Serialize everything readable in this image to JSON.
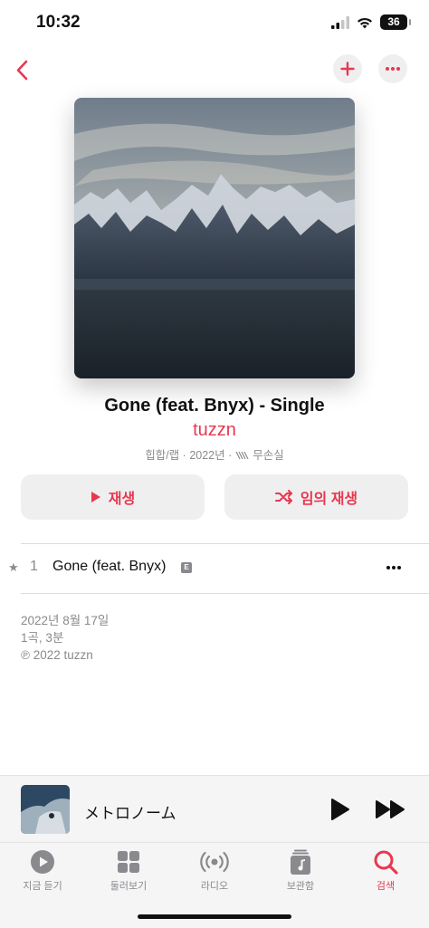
{
  "status_bar": {
    "time": "10:32",
    "battery": "36"
  },
  "album": {
    "title": "Gone (feat. Bnyx) - Single",
    "artist": "tuzzn",
    "genre": "힙합/랩",
    "year": "2022년",
    "lossless": "무손실",
    "separator": "·"
  },
  "actions": {
    "play_label": "재생",
    "shuffle_label": "임의 재생"
  },
  "tracks": [
    {
      "number": "1",
      "title": "Gone (feat. Bnyx)",
      "explicit": "E",
      "star": "★"
    }
  ],
  "info": {
    "release_date": "2022년 8월 17일",
    "summary": "1곡, 3분",
    "copyright": "℗ 2022 tuzzn"
  },
  "now_playing": {
    "title": "メトロノーム"
  },
  "tabs": [
    {
      "label": "지금 듣기",
      "icon": "play-circle-icon"
    },
    {
      "label": "둘러보기",
      "icon": "grid-icon"
    },
    {
      "label": "라디오",
      "icon": "radio-icon"
    },
    {
      "label": "보관함",
      "icon": "library-icon"
    },
    {
      "label": "검색",
      "icon": "search-icon",
      "active": true
    }
  ],
  "colors": {
    "accent": "#e8384f",
    "secondary_text": "#8a8a8e",
    "button_bg": "#efeff0"
  }
}
